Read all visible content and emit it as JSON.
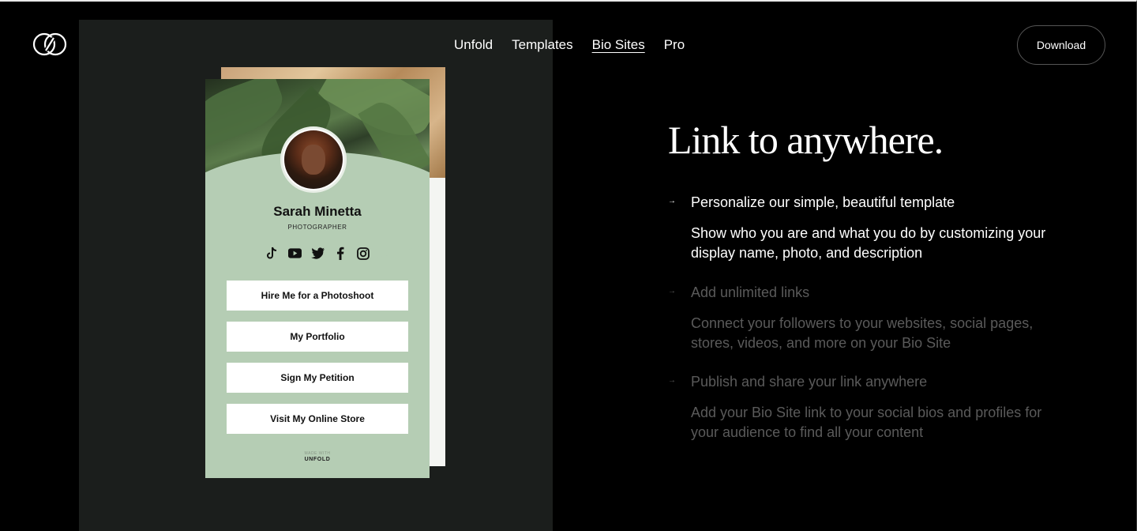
{
  "header": {
    "nav": [
      "Unfold",
      "Templates",
      "Bio Sites",
      "Pro"
    ],
    "active_nav": "Bio Sites",
    "download_label": "Download"
  },
  "card": {
    "name": "Sarah Minetta",
    "role": "PHOTOGRAPHER",
    "socials": [
      "tiktok-icon",
      "youtube-icon",
      "twitter-icon",
      "facebook-icon",
      "instagram-icon"
    ],
    "links": [
      "Hire Me for a Photoshoot",
      "My Portfolio",
      "Sign My Petition",
      "Visit My Online Store"
    ],
    "made_with": "MADE WITH",
    "made_brand": "UNFOLD"
  },
  "content": {
    "headline": "Link to anywhere.",
    "features": [
      {
        "title": "Personalize our simple, beautiful template",
        "desc": "Show who you are and what you do by customizing your display name, photo, and description"
      },
      {
        "title": "Add unlimited links",
        "desc": "Connect your followers to your websites, social pages, stores, videos, and more on your Bio Site"
      },
      {
        "title": "Publish and share your link anywhere",
        "desc": "Add your Bio Site link to your social bios and profiles for your audience to find all your content"
      }
    ]
  },
  "colors": {
    "card_green": "#b5cdb4",
    "panel_dark": "#1b1e1c",
    "dim_text": "#5a5a5a"
  }
}
